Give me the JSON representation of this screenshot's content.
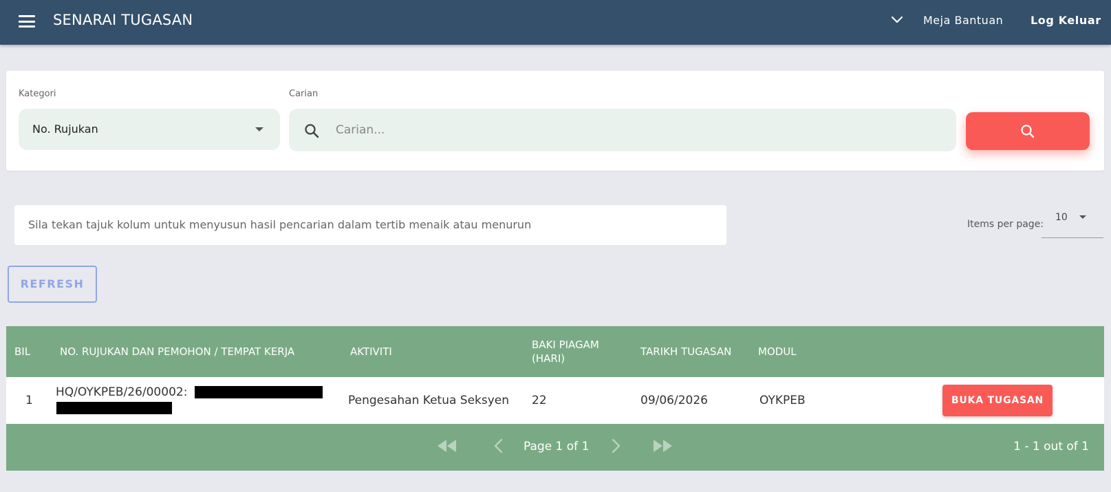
{
  "header": {
    "title": "SENARAI TUGASAN",
    "help_label": "Meja Bantuan",
    "logout_label": "Log Keluar"
  },
  "filter": {
    "category_label": "Kategori",
    "category_value": "No. Rujukan",
    "search_label": "Carian",
    "search_placeholder": "Carian...",
    "search_value": ""
  },
  "hint": "Sila tekan tajuk kolum untuk menyusun hasil pencarian dalam tertib menaik atau menurun",
  "paging_size": {
    "label": "Items per page:",
    "value": "10"
  },
  "refresh_label": "REFRESH",
  "table": {
    "columns": [
      "BIL",
      "NO. RUJUKAN DAN PEMOHON / TEMPAT KERJA",
      "AKTIVITI",
      "BAKI PIAGAM (HARI)",
      "TARIKH TUGASAN",
      "MODUL"
    ],
    "rows": [
      {
        "bil": "1",
        "ref": "HQ/OYKPEB/26/00002:",
        "activity": "Pengesahan Ketua Seksyen",
        "balance": "22",
        "date": "09/06/2026",
        "module": "OYKPEB",
        "action_label": "BUKA TUGASAN"
      }
    ]
  },
  "pagination": {
    "page_text": "Page 1 of 1",
    "range_text": "1 - 1 out of 1"
  },
  "colors": {
    "header_bg": "#34506a",
    "table_green": "#7aaa85",
    "accent_red": "#fa5a55",
    "refresh_blue": "#8fa6e6"
  }
}
